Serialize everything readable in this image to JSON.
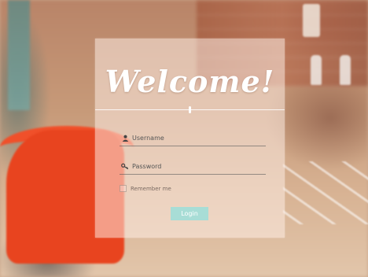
{
  "card": {
    "title": "Welcome!",
    "username_placeholder": "Username",
    "password_placeholder": "Password",
    "remember_label": "Remember me",
    "login_label": "Login"
  },
  "colors": {
    "login_button": "#a8ddd6",
    "card_background": "rgba(255,240,232,0.52)"
  },
  "icons": {
    "username": "user-icon",
    "password": "key-icon"
  }
}
